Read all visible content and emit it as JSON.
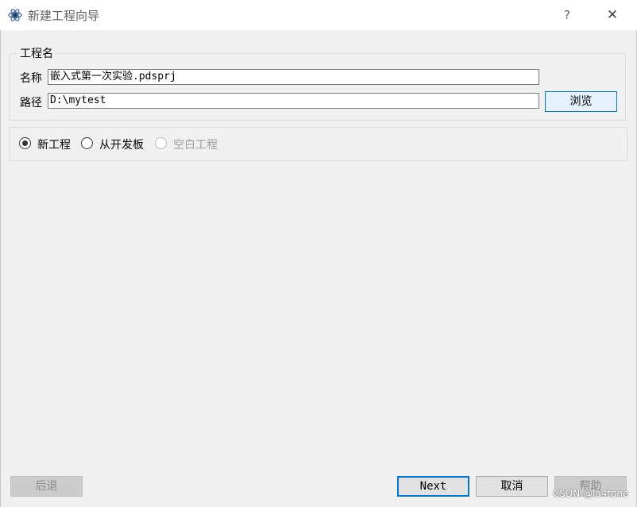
{
  "window": {
    "title": "新建工程向导",
    "help_glyph": "?",
    "close_glyph": "✕",
    "icon": "app-logo-icon"
  },
  "project_group": {
    "title": "工程名",
    "name_label": "名称",
    "name_value": "嵌入式第一次实验.pdsprj",
    "path_label": "路径",
    "path_value": "D:\\mytest",
    "browse_label": "浏览"
  },
  "project_type": {
    "options": [
      {
        "label": "新工程",
        "selected": true,
        "enabled": true
      },
      {
        "label": "从开发板",
        "selected": false,
        "enabled": true
      },
      {
        "label": "空白工程",
        "selected": false,
        "enabled": false
      }
    ]
  },
  "footer": {
    "back_label": "后退",
    "next_label": "Next",
    "cancel_label": "取消",
    "help_label": "帮助"
  },
  "watermark": "CSDN @la4tone",
  "colors": {
    "accent": "#0078d7",
    "background": "#f0f0f0",
    "titlebar": "#ffffff"
  }
}
